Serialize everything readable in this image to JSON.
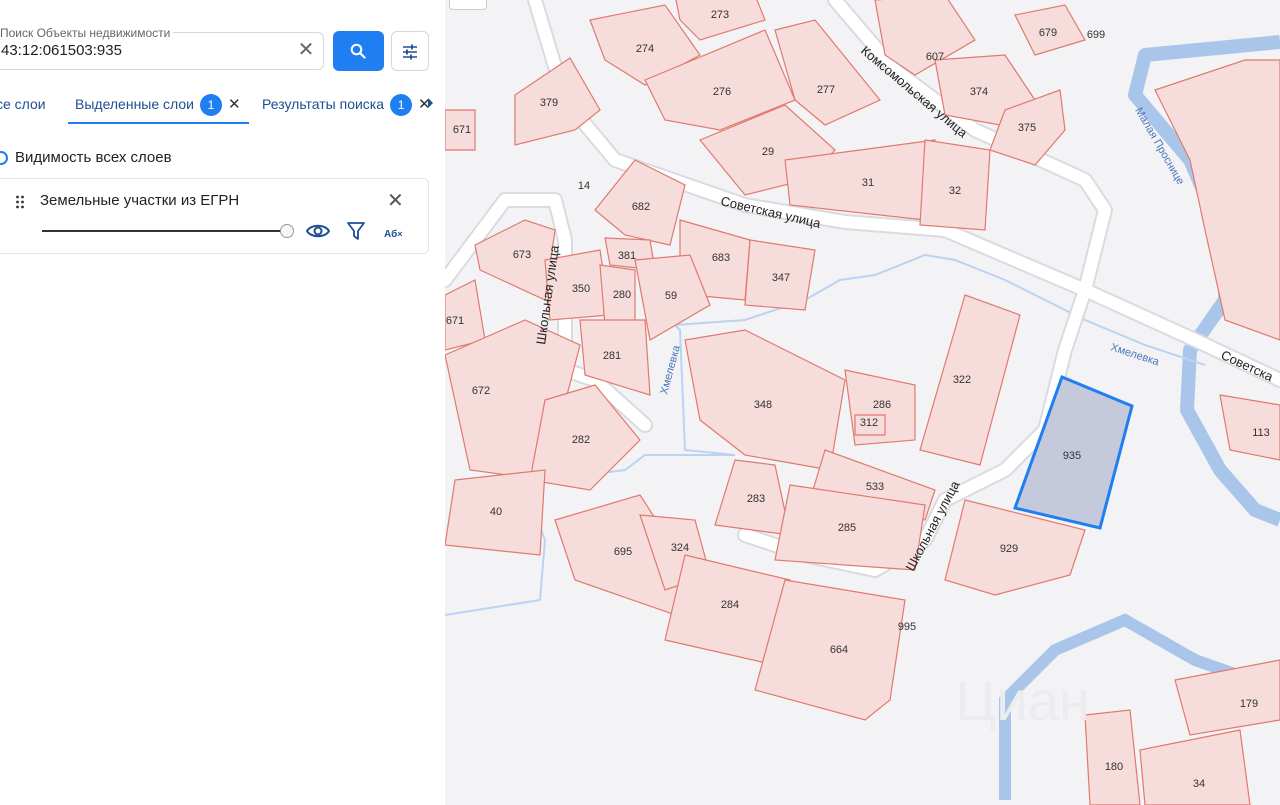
{
  "search": {
    "label": "Поиск Объекты недвижимости",
    "value": "43:12:061503:935"
  },
  "tabs": [
    {
      "label": "се слои"
    },
    {
      "label": "Выделенные слои",
      "badge": "1"
    },
    {
      "label": "Результаты поиска",
      "badge": "1"
    }
  ],
  "visibility_label": "Видимость всех слоев",
  "layer": {
    "title": "Земельные участки из ЕГРН",
    "opacity_percent": 100,
    "text_icon": "Аб"
  },
  "colors": {
    "accent": "#1e7ef2",
    "parcel_fill": "#f7dcdc",
    "parcel_stroke": "#e07a6e",
    "selected_fill": "#c4c9dc",
    "selected_stroke": "#1e7ef2",
    "river": "#a9c6ea",
    "road": "#ffffff"
  },
  "map": {
    "streets": [
      "Советская улица",
      "Комсомольская улица",
      "Школьная улица",
      "Школьная улица",
      "Советска"
    ],
    "rivers": [
      "Хмелевка",
      "Хмелевка",
      "Малая Проснице"
    ],
    "parcels": [
      "607",
      "273",
      "274",
      "276",
      "277",
      "379",
      "671",
      "29",
      "374",
      "375",
      "679",
      "699",
      "31",
      "32",
      "14",
      "682",
      "673",
      "381",
      "683",
      "347",
      "350",
      "280",
      "59",
      "671",
      "281",
      "322",
      "672",
      "348",
      "286",
      "312",
      "935",
      "282",
      "113",
      "283",
      "533",
      "40",
      "285",
      "929",
      "695",
      "324",
      "284",
      "995",
      "664",
      "179",
      "180",
      "34"
    ],
    "selected_parcel": "935",
    "watermark": "Циан"
  }
}
